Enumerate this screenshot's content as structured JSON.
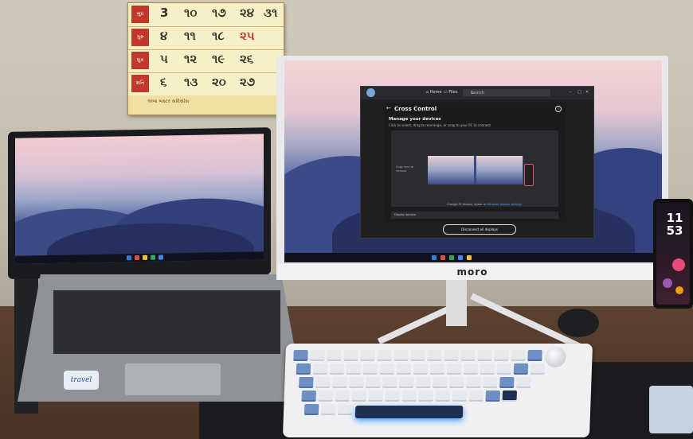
{
  "calendar": {
    "rows": [
      {
        "day_label": "બુધ",
        "dates": [
          "3",
          "૧૦",
          "૧૭",
          "૨૪",
          "૩૧"
        ]
      },
      {
        "day_label": "ગુરુ",
        "dates": [
          "૪",
          "૧૧",
          "૧૮",
          "૨૫"
        ]
      },
      {
        "day_label": "શુક્ર",
        "dates": [
          "૫",
          "૧૨",
          "૧૯",
          "૨૬"
        ]
      },
      {
        "day_label": "શનિ",
        "dates": [
          "૬",
          "૧૩",
          "૨૦",
          "૨૭"
        ]
      }
    ],
    "footer_text": "અંબા બસ્ટર સર્વિસીસ"
  },
  "monitor": {
    "brand_logo": "moro",
    "app_window": {
      "nav_home": "Home",
      "nav_files": "Files",
      "search_placeholder": "Search",
      "page_title": "Cross Control",
      "section_title": "Manage your devices",
      "section_subtitle": "Click to select, drag to rearrange, or snap to your PC to connect",
      "drag_hint": "Drag here to remove",
      "change_display_prefix": "Change PC display layout in",
      "change_display_link": "Windows display settings",
      "display_options_label": "Display options",
      "disconnect_button": "Disconnect all displays"
    }
  },
  "laptop": {
    "sticker_text": "travel"
  },
  "phone": {
    "time_hours": "11",
    "time_minutes": "53"
  },
  "colors": {
    "wall": "#c9c3b6",
    "desk": "#533a2b",
    "keyboard_accent": "#6e8fc4",
    "app_background": "#1f1f22",
    "link_blue": "#5aa0ff"
  }
}
